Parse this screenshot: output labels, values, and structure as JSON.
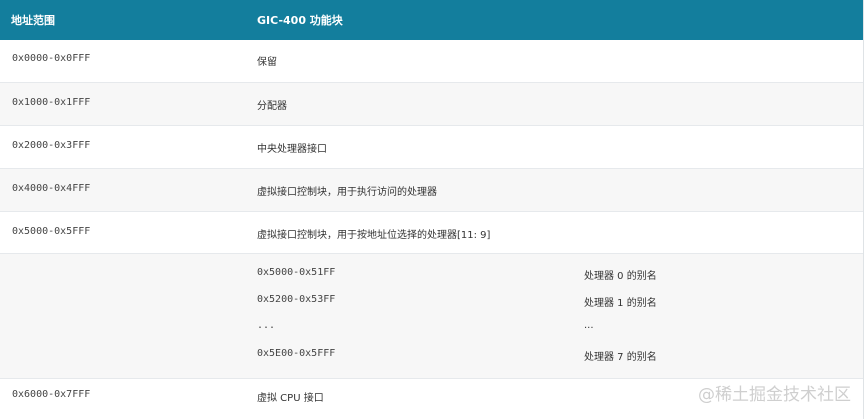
{
  "table": {
    "headers": [
      "地址范围",
      "GIC-400 功能块"
    ],
    "rows": [
      {
        "range": "0x0000-0x0FFF",
        "block": "保留"
      },
      {
        "range": "0x1000-0x1FFF",
        "block": "分配器"
      },
      {
        "range": "0x2000-0x3FFF",
        "block": "中央处理器接口"
      },
      {
        "range": "0x4000-0x4FFF",
        "block": "虚拟接口控制块，用于执行访问的处理器"
      },
      {
        "range": "0x5000-0x5FFF",
        "block": "虚拟接口控制块，用于按地址位选择的处理器[11: 9]"
      }
    ],
    "sub_rows": [
      {
        "range": "0x5000-0x51FF",
        "alias": "处理器 0 的别名"
      },
      {
        "range": "0x5200-0x53FF",
        "alias": "处理器 1 的别名"
      },
      {
        "range": "...",
        "alias": "..."
      },
      {
        "range": "0x5E00-0x5FFF",
        "alias": "处理器 7 的别名"
      }
    ],
    "last_row": {
      "range": "0x6000-0x7FFF",
      "block": "虚拟 CPU 接口"
    }
  },
  "watermark": "@稀土掘金技术社区"
}
